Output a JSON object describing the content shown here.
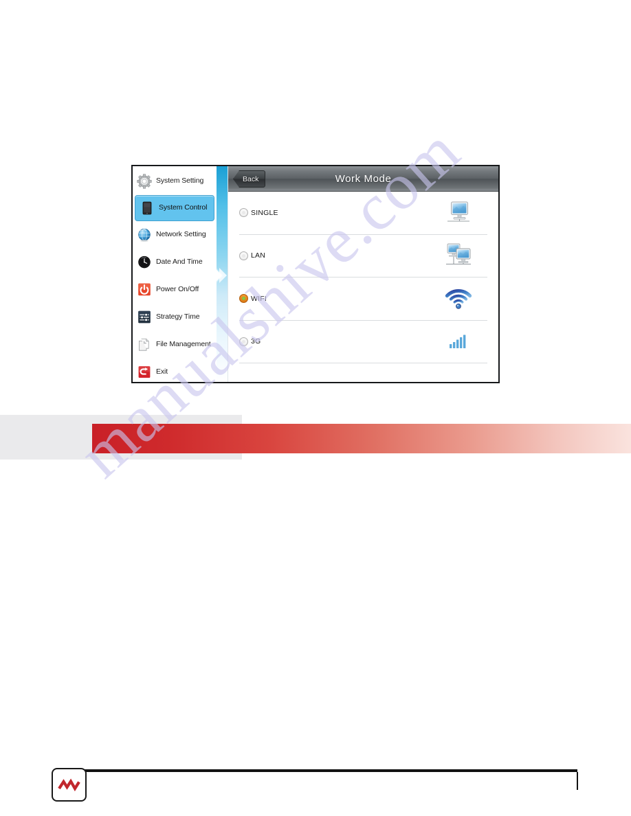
{
  "device": {
    "sidebar": {
      "items": [
        {
          "label": "System Setting",
          "icon": "gear-icon",
          "selected": false
        },
        {
          "label": "System Control",
          "icon": "tablet-icon",
          "selected": true
        },
        {
          "label": "Network Setting",
          "icon": "globe-icon",
          "selected": false
        },
        {
          "label": "Date And Time",
          "icon": "clock-icon",
          "selected": false
        },
        {
          "label": "Power On/Off",
          "icon": "power-icon",
          "selected": false
        },
        {
          "label": "Strategy Time",
          "icon": "strategy-icon",
          "selected": false
        },
        {
          "label": "File Management",
          "icon": "file-icon",
          "selected": false
        },
        {
          "label": "Exit",
          "icon": "exit-icon",
          "selected": false
        }
      ]
    },
    "header": {
      "back_label": "Back",
      "title": "Work Mode"
    },
    "options": [
      {
        "label": "SINGLE",
        "icon": "monitor-icon",
        "selected": false
      },
      {
        "label": "LAN",
        "icon": "two-monitors-icon",
        "selected": false
      },
      {
        "label": "WIFI",
        "icon": "wifi-icon",
        "selected": true
      },
      {
        "label": "3G",
        "icon": "signal-bars-icon",
        "selected": false
      }
    ]
  },
  "page": {
    "watermark": "manualshive.com",
    "footer_logo_name": "brand-logo"
  },
  "colors": {
    "selected_item": "#62c3ee",
    "radio_selected": "#e8841c",
    "radio_selected_dot": "#8cc63f",
    "banner_red": "#c92027",
    "banner_grey": "#eaeaec",
    "titlebar_grey": "#5c6165",
    "divider_blue": "#51bfe8",
    "logo_red": "#c1272d"
  }
}
